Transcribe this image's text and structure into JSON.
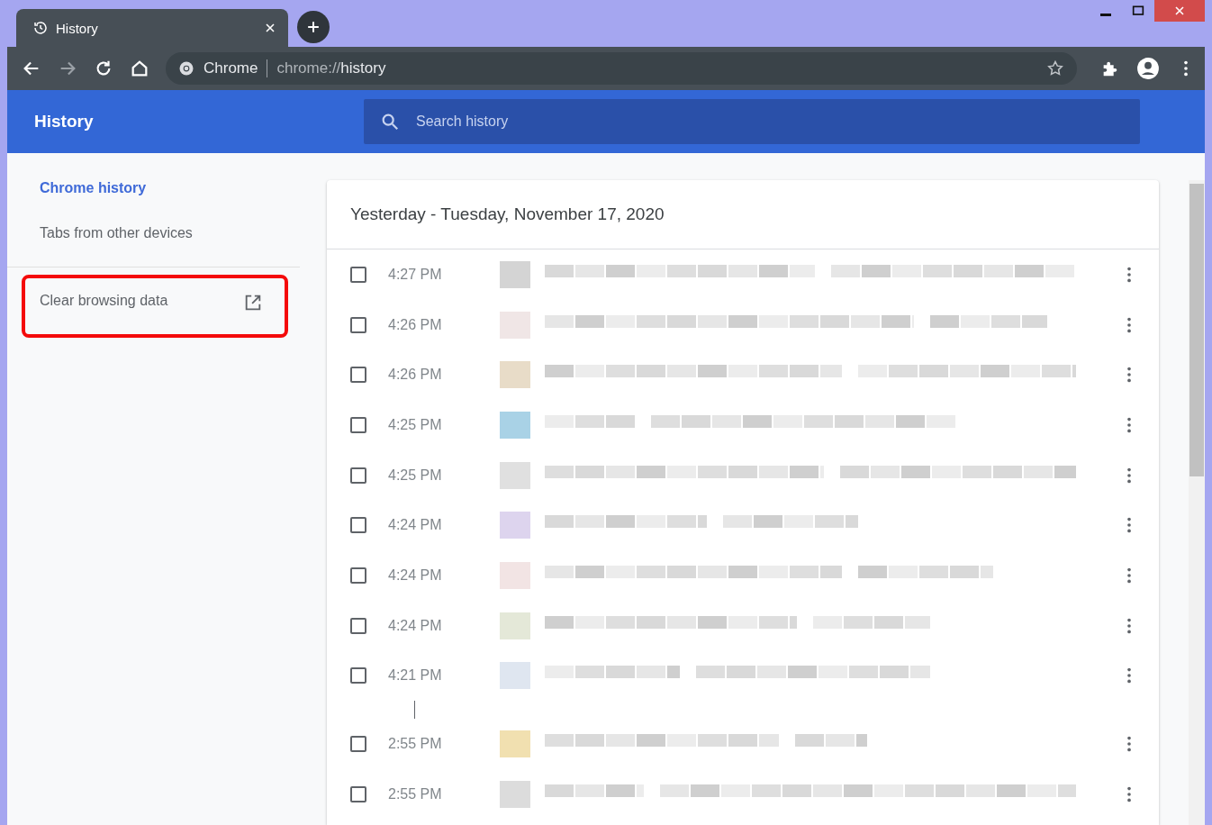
{
  "tab": {
    "title": "History",
    "selected": true
  },
  "omnibox": {
    "site": "Chrome",
    "url_prefix": "chrome://",
    "url_path": "history"
  },
  "header": {
    "title": "History",
    "search": {
      "placeholder": "Search history"
    }
  },
  "sidebar": {
    "items": [
      {
        "label": "Chrome history",
        "selected": true
      },
      {
        "label": "Tabs from other devices",
        "selected": false
      }
    ],
    "clear": {
      "label": "Clear browsing data",
      "highlighted": true
    }
  },
  "day": {
    "title": "Yesterday - Tuesday, November 17, 2020",
    "groups": [
      [
        {
          "time": "4:27 PM",
          "checked": false
        },
        {
          "time": "4:26 PM",
          "checked": false
        },
        {
          "time": "4:26 PM",
          "checked": false
        },
        {
          "time": "4:25 PM",
          "checked": false
        },
        {
          "time": "4:25 PM",
          "checked": false
        },
        {
          "time": "4:24 PM",
          "checked": false
        },
        {
          "time": "4:24 PM",
          "checked": false
        },
        {
          "time": "4:24 PM",
          "checked": false
        },
        {
          "time": "4:21 PM",
          "checked": false
        }
      ],
      [
        {
          "time": "2:55 PM",
          "checked": false
        },
        {
          "time": "2:55 PM",
          "checked": false
        }
      ]
    ]
  }
}
